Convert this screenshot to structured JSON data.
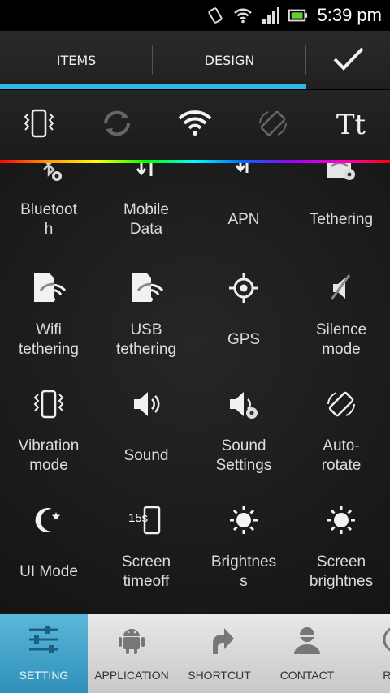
{
  "status": {
    "time": "5:39 pm"
  },
  "tabs": [
    {
      "label": "ITEMS"
    },
    {
      "label": "DESIGN"
    }
  ],
  "toggles": [
    {
      "icon": "vibrate-icon"
    },
    {
      "icon": "sync-icon"
    },
    {
      "icon": "wifi-icon"
    },
    {
      "icon": "auto-rotate-icon"
    },
    {
      "icon": "font-size-icon",
      "text": "Tt"
    }
  ],
  "items": [
    {
      "label": "Bluetoot\nh",
      "icon": "bluetooth-settings-icon"
    },
    {
      "label": "Mobile\nData",
      "icon": "mobile-data-icon"
    },
    {
      "label": "APN",
      "icon": "apn-icon"
    },
    {
      "label": "Tethering",
      "icon": "tethering-icon"
    },
    {
      "label": "Wifi\ntethering",
      "icon": "wifi-tethering-icon"
    },
    {
      "label": "USB\ntethering",
      "icon": "usb-tethering-icon"
    },
    {
      "label": "GPS",
      "icon": "gps-icon"
    },
    {
      "label": "Silence\nmode",
      "icon": "silence-icon"
    },
    {
      "label": "Vibration\nmode",
      "icon": "vibration-icon"
    },
    {
      "label": "Sound",
      "icon": "sound-icon"
    },
    {
      "label": "Sound\nSettings",
      "icon": "sound-settings-icon"
    },
    {
      "label": "Auto-\nrotate",
      "icon": "rotate-icon"
    },
    {
      "label": "UI Mode",
      "icon": "ui-mode-icon"
    },
    {
      "label": "Screen\ntimeoff",
      "icon": "screen-timeout-icon",
      "badge": "15s"
    },
    {
      "label": "Brightnes\ns",
      "icon": "brightness-icon"
    },
    {
      "label": "Screen\nbrightnes",
      "icon": "screen-brightness-icon"
    }
  ],
  "bottom_nav": [
    {
      "label": "SETTING",
      "icon": "sliders-icon",
      "active": true
    },
    {
      "label": "APPLICATION",
      "icon": "android-icon"
    },
    {
      "label": "SHORTCUT",
      "icon": "shortcut-arrow-icon"
    },
    {
      "label": "CONTACT",
      "icon": "contact-icon"
    },
    {
      "label": "REC",
      "icon": "recent-icon"
    }
  ],
  "colors": {
    "accent": "#33b5e5",
    "active_nav": "#3a9cc4"
  }
}
